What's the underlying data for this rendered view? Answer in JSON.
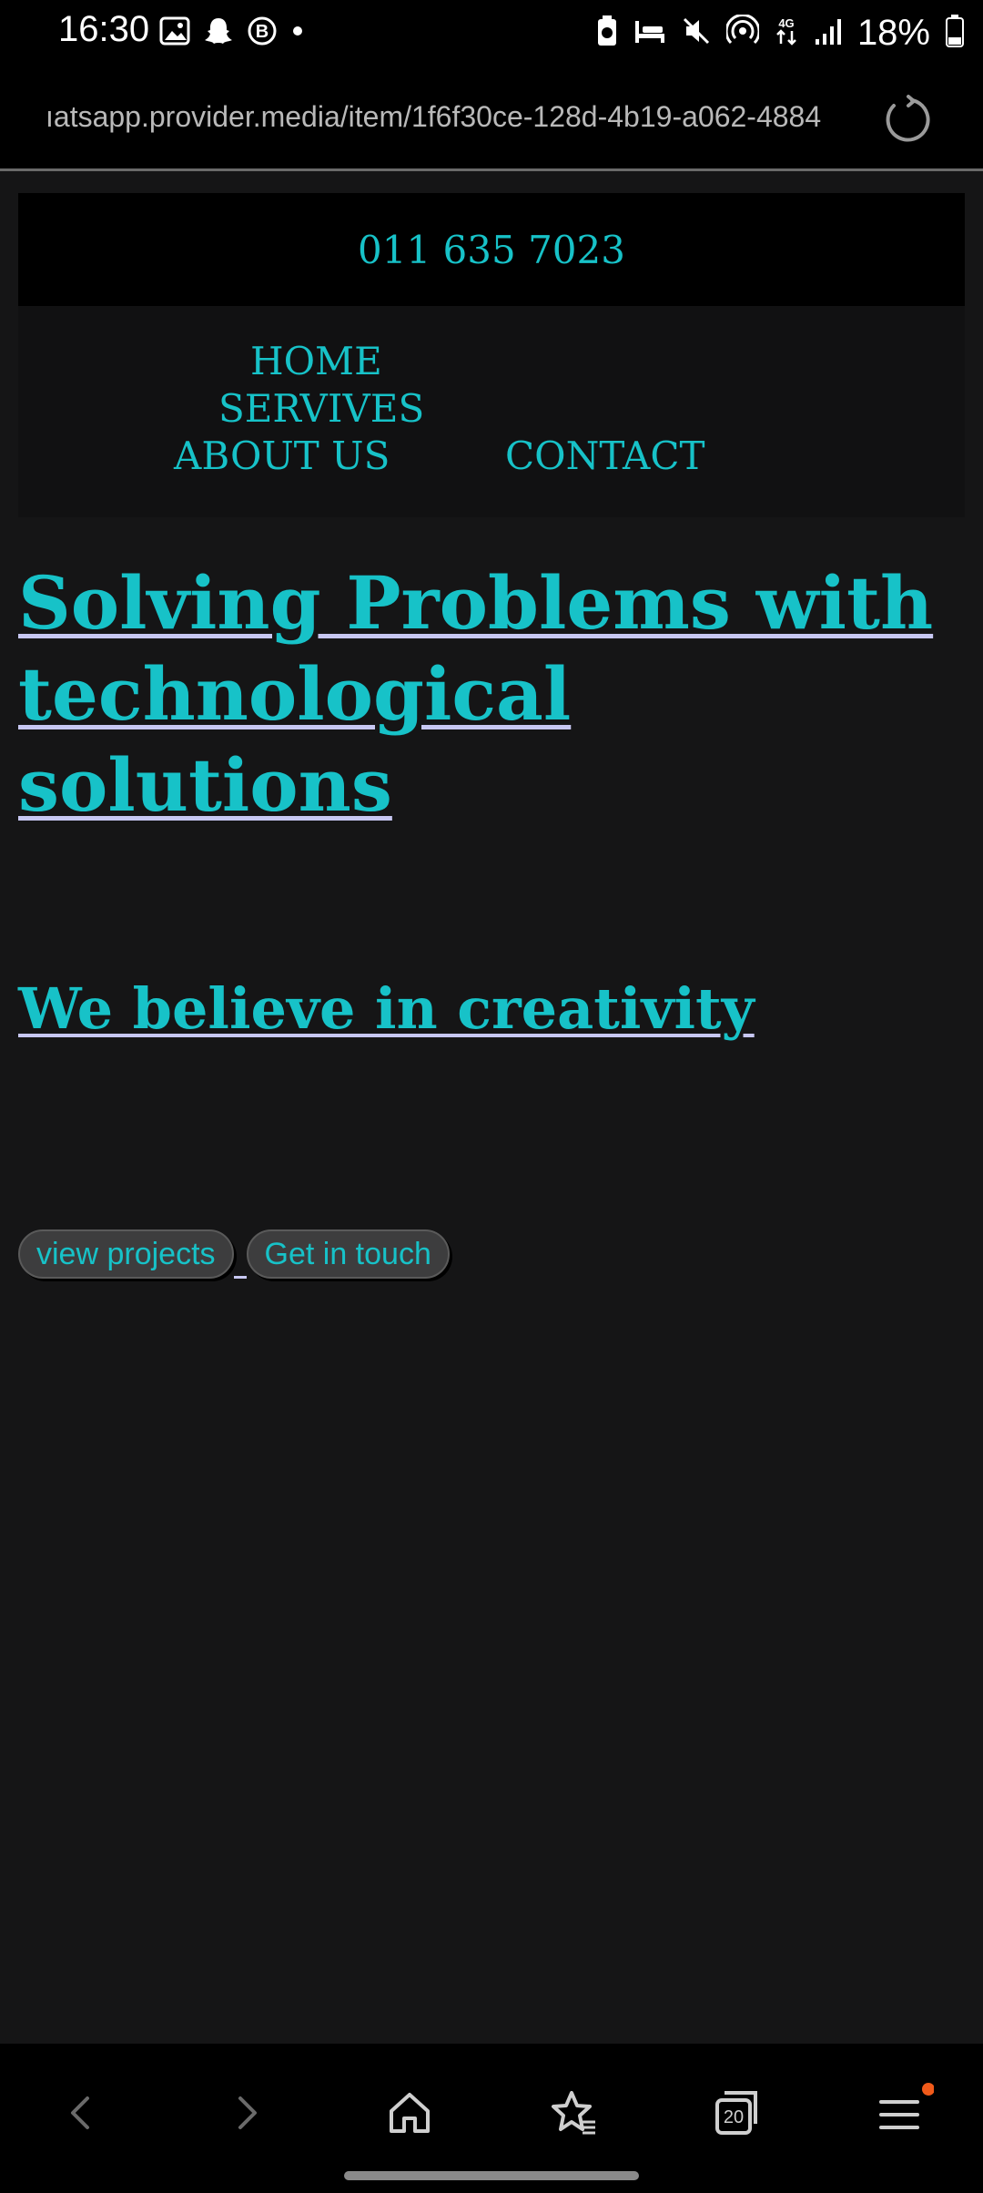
{
  "status_bar": {
    "time": "16:30",
    "battery": "18%",
    "left_icons": [
      "gallery-icon",
      "snapchat-icon",
      "b-badge-icon",
      "dot-icon"
    ],
    "right_icons": [
      "battery-saver-icon",
      "sleep-icon",
      "mute-icon",
      "hotspot-icon",
      "4g-icon",
      "signal-icon",
      "battery-icon"
    ]
  },
  "browser": {
    "url": "ıatsapp.provider.media/item/1f6f30ce-128d-4b19-a062-4884"
  },
  "site": {
    "phone": "011 635 7023",
    "nav": {
      "home": "HOME",
      "services": "SERVIVES",
      "about": "ABOUT US",
      "contact": "CONTACT"
    },
    "headline": "Solving Problems with technological solutions",
    "subheadline": "We believe in creativity",
    "buttons": {
      "projects": "view projects",
      "contact": "Get in touch"
    }
  },
  "bottom_nav": {
    "tab_count": "20",
    "items": [
      "back-icon",
      "forward-icon",
      "home-icon",
      "bookmarks-icon",
      "tabs-icon",
      "menu-icon"
    ]
  },
  "colors": {
    "accent": "#17c2c8",
    "background": "#151516",
    "underline": "#c7c7f2",
    "notification_dot": "#f05a1a"
  }
}
